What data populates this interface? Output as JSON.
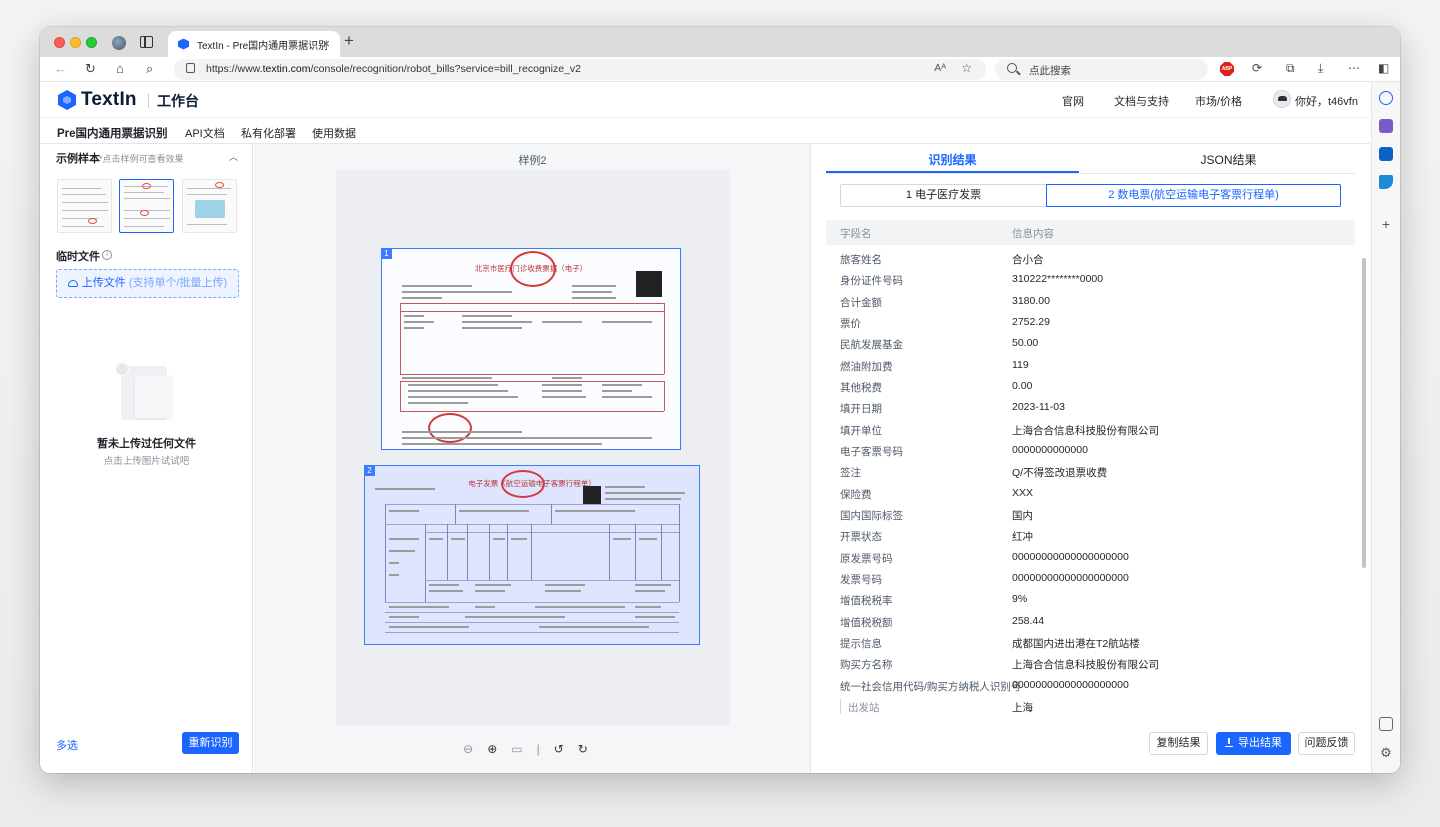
{
  "browser": {
    "tab_title": "TextIn - Pre国内通用票据识别",
    "url_prefix": "https://www.",
    "url_domain": "textin.com",
    "url_path": "/console/recognition/robot_bills?service=bill_recognize_v2",
    "search_placeholder": "点此搜索",
    "abp_label": "ABP"
  },
  "header": {
    "brand": "TextIn",
    "workspace": "工作台",
    "nav": [
      "官网",
      "文档与支持",
      "市场/价格"
    ],
    "greeting": "你好，t46vfn"
  },
  "subnav": {
    "title": "Pre国内通用票据识别",
    "items": [
      "API文档",
      "私有化部署",
      "使用数据"
    ]
  },
  "left": {
    "samples_title": "示例样本",
    "samples_hint": "*点击样例可查看效果",
    "temp_title": "临时文件",
    "upload_label": "上传文件",
    "upload_sub": "(支持单个/批量上传)",
    "empty_title": "暂未上传过任何文件",
    "empty_sub": "点击上传图片试试吧",
    "multi_select": "多选",
    "rerun": "重新识别"
  },
  "center": {
    "sample_label": "样例2",
    "doc1_number": "1",
    "doc1_title": "北京市医疗门诊收费票据（电子）",
    "doc2_number": "2",
    "doc2_title": "电子发票（航空运输电子客票行程单）"
  },
  "right": {
    "tabs": [
      "识别结果",
      "JSON结果"
    ],
    "segments": [
      "1 电子医疗发票",
      "2 数电票(航空运输电子客票行程单)"
    ],
    "columns": [
      "字段名",
      "信息内容"
    ],
    "rows": [
      {
        "k": "旅客姓名",
        "v": "合小合"
      },
      {
        "k": "身份证件号码",
        "v": "310222********0000"
      },
      {
        "k": "合计金额",
        "v": "3180.00"
      },
      {
        "k": "票价",
        "v": "2752.29"
      },
      {
        "k": "民航发展基金",
        "v": "50.00"
      },
      {
        "k": "燃油附加费",
        "v": "119"
      },
      {
        "k": "其他税费",
        "v": "0.00"
      },
      {
        "k": "填开日期",
        "v": "2023-11-03"
      },
      {
        "k": "填开单位",
        "v": "上海合合信息科技股份有限公司"
      },
      {
        "k": "电子客票号码",
        "v": "0000000000000"
      },
      {
        "k": "签注",
        "v": "Q/不得签改退票收费"
      },
      {
        "k": "保险费",
        "v": "XXX"
      },
      {
        "k": "国内国际标签",
        "v": "国内"
      },
      {
        "k": "开票状态",
        "v": "红冲"
      },
      {
        "k": "原发票号码",
        "v": "00000000000000000000"
      },
      {
        "k": "发票号码",
        "v": "00000000000000000000"
      },
      {
        "k": "增值税税率",
        "v": "9%"
      },
      {
        "k": "增值税税额",
        "v": "258.44"
      },
      {
        "k": "提示信息",
        "v": "成都国内进出港在T2航站楼"
      },
      {
        "k": "购买方名称",
        "v": "上海合合信息科技股份有限公司"
      },
      {
        "k": "统一社会信用代码/购买方纳税人识别号",
        "v": "00000000000000000000"
      },
      {
        "k": "出发站",
        "v": "上海"
      }
    ],
    "buttons": [
      "复制结果",
      "导出结果",
      "问题反馈"
    ]
  },
  "colors": {
    "accent": "#1a66ff",
    "stamp_red": "#d23b3b"
  }
}
